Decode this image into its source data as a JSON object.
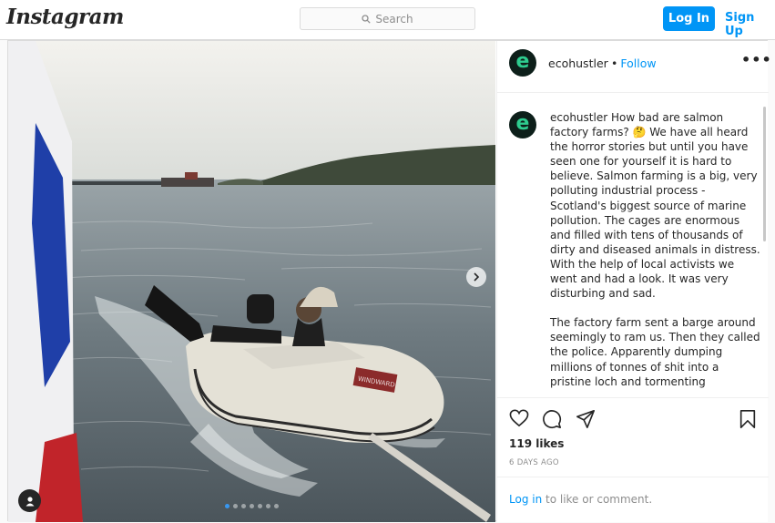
{
  "header": {
    "logo": "Instagram",
    "search_placeholder": "Search",
    "login_label": "Log In",
    "signup_label": "Sign Up"
  },
  "post": {
    "username": "ecohustler",
    "follow_separator": "•",
    "follow_label": "Follow",
    "more_label": "•••",
    "avatar_letter": "e",
    "boat_label": "WINDWARD",
    "caption_user": "ecohustler",
    "caption_paragraphs": [
      "How bad are salmon factory farms? 🤔 We have all heard the horror stories but until you have seen one for yourself it is hard to believe. Salmon farming is a big, very polluting industrial process - Scotland's biggest source of marine pollution. The cages are enormous and filled with tens of thousands of dirty and diseased animals in distress. With the help of local activists we went and had a look. It was very disturbing and sad.",
      "The factory farm sent a barge around seemingly to ram us. Then they called the police. Apparently dumping millions of tonnes of shit into a pristine loch and tormenting"
    ],
    "likes": "119 likes",
    "time": "6 DAYS AGO",
    "login_link": "Log in",
    "login_suffix": " to like or comment.",
    "carousel_count": 7,
    "carousel_active": 1
  },
  "colors": {
    "accent": "#0095f6",
    "border": "#dbdbdb",
    "muted": "#8e8e8e"
  },
  "icons": [
    "search-icon",
    "heart-icon",
    "comment-icon",
    "share-icon",
    "bookmark-icon",
    "chevron-right-icon",
    "user-tag-icon"
  ]
}
